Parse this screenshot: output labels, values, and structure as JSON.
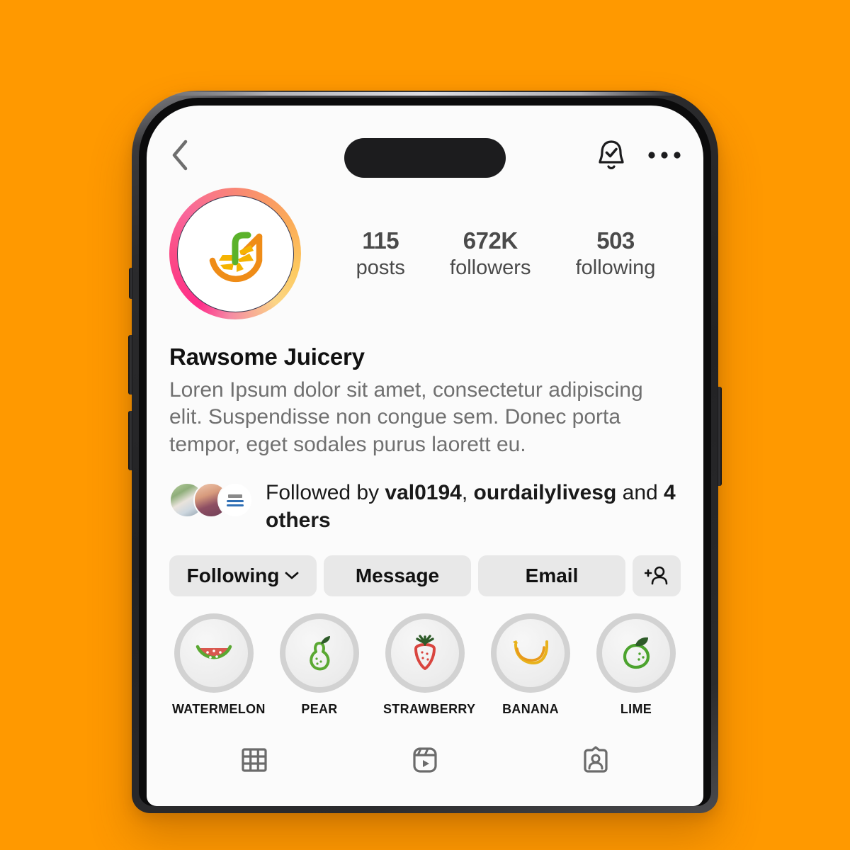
{
  "background_color": "#FF9900",
  "device": {
    "name": "iphone-mockup",
    "frame_color": "#222224",
    "buttons": [
      "silent-switch",
      "volume-up",
      "volume-down",
      "power-button"
    ],
    "has_dynamic_island": true
  },
  "nav": {
    "back_icon": "back-chevron-icon",
    "notifications_icon": "bell-check-icon",
    "more_icon": "more-options-icon"
  },
  "profile": {
    "avatar_icon": "orange-slice-juice-logo",
    "has_story_ring": true,
    "display_name": "Rawsome Juicery",
    "bio": "Loren Ipsum dolor sit amet, consectetur adipiscing elit. Suspendisse non congue sem. Donec porta tempor, eget sodales purus laorett eu."
  },
  "stats": [
    {
      "value": "115",
      "label": "posts"
    },
    {
      "value": "672K",
      "label": "followers"
    },
    {
      "value": "503",
      "label": "following"
    }
  ],
  "followed_by": {
    "prefix": "Followed by ",
    "user_1": "val0194",
    "separator": ", ",
    "user_2": "ourdailylivesg",
    "middle": " and ",
    "others": "4 others",
    "avatar_count": 3
  },
  "actions": [
    {
      "label": "Following",
      "icon": "chevron-down-icon",
      "name": "following-button"
    },
    {
      "label": "Message",
      "icon": "",
      "name": "message-button"
    },
    {
      "label": "Email",
      "icon": "",
      "name": "email-button"
    },
    {
      "label": "",
      "icon": "add-user-icon",
      "name": "add-user-button"
    }
  ],
  "highlights": [
    {
      "label": "WATERMELON",
      "icon": "watermelon-icon",
      "color": "#d9584f"
    },
    {
      "label": "PEAR",
      "icon": "pear-icon",
      "color": "#5aa832"
    },
    {
      "label": "STRAWBERRY",
      "icon": "strawberry-icon",
      "color": "#d9453f"
    },
    {
      "label": "BANANA",
      "icon": "banana-icon",
      "color": "#e8b21b"
    },
    {
      "label": "LIME",
      "icon": "lime-icon",
      "color": "#4ca32e"
    }
  ],
  "tabs": [
    {
      "name": "grid-tab",
      "icon": "grid-icon"
    },
    {
      "name": "reels-tab",
      "icon": "reels-icon"
    },
    {
      "name": "tagged-tab",
      "icon": "tagged-icon"
    }
  ]
}
